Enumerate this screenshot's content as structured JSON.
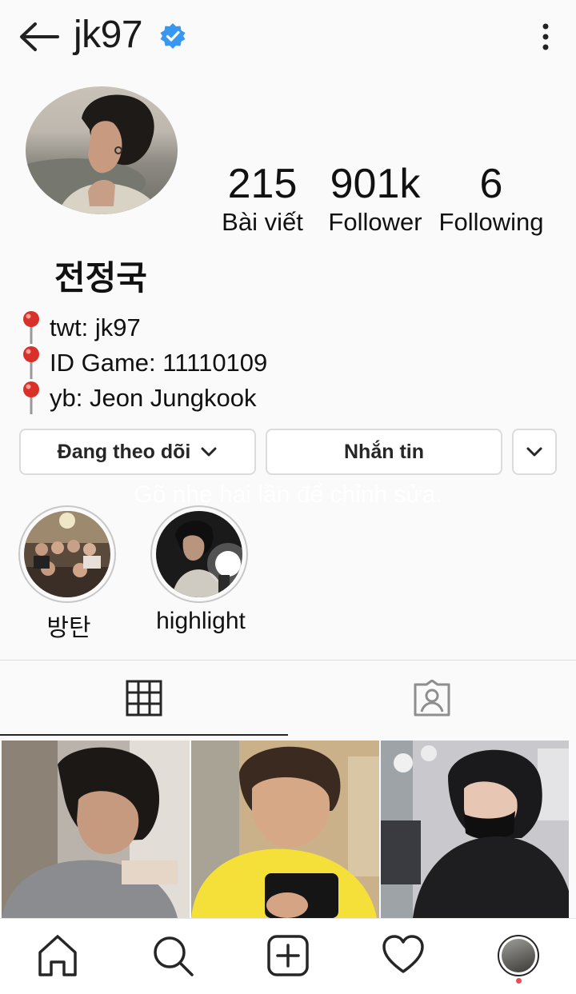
{
  "header": {
    "username": "jk97",
    "icons": {
      "back": "back-arrow-icon",
      "verified": "verified-badge-icon",
      "more": "more-vertical-icon"
    },
    "verified_color": "#3897f0"
  },
  "profile": {
    "display_name": "전정국",
    "stats": [
      {
        "value": "215",
        "label": "Bài viết"
      },
      {
        "value": "901k",
        "label": "Follower"
      },
      {
        "value": "6",
        "label": "Following"
      }
    ],
    "bio": [
      {
        "icon": "pushpin-icon",
        "text": "twt: jk97"
      },
      {
        "icon": "pushpin-icon",
        "text": "ID Game: 11110109"
      },
      {
        "icon": "pushpin-icon",
        "text": "yb: Jeon Jungkook"
      }
    ]
  },
  "actions": {
    "following_label": "Đang theo dõi",
    "message_label": "Nhắn tin"
  },
  "hint": "Gõ nhẹ hai lần để chỉnh sửa.",
  "highlights": [
    {
      "label": "방탄"
    },
    {
      "label": "highlight"
    }
  ],
  "tabs": [
    {
      "icon": "grid-icon",
      "active": true
    },
    {
      "icon": "tagged-user-icon",
      "active": false
    }
  ],
  "bottom_nav": [
    {
      "icon": "home-icon"
    },
    {
      "icon": "search-icon"
    },
    {
      "icon": "add-post-icon"
    },
    {
      "icon": "heart-icon"
    },
    {
      "icon": "profile-avatar-icon"
    }
  ],
  "colors": {
    "notification_dot": "#ed4956",
    "border": "#dbdbdb"
  }
}
